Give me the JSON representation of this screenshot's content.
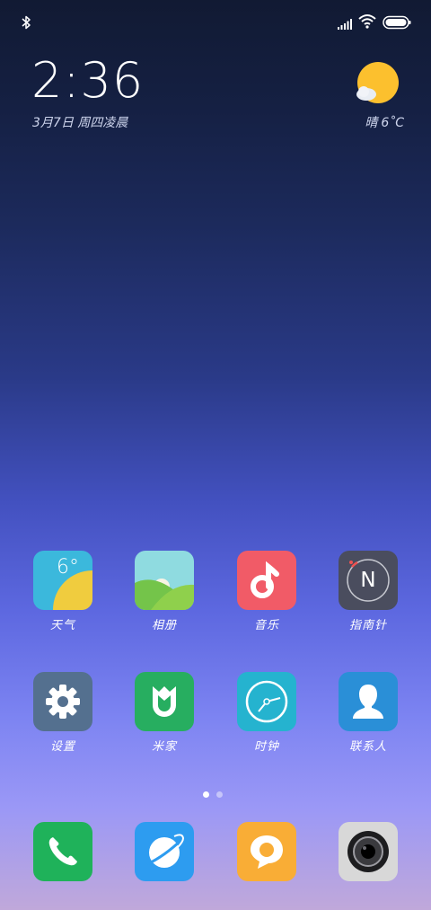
{
  "status_bar": {
    "icons": [
      "bluetooth-icon",
      "signal-icon",
      "wifi-icon",
      "battery-icon"
    ]
  },
  "clock_widget": {
    "time": "2:36",
    "date": "3月7日 周四凌晨"
  },
  "weather_widget": {
    "condition": "晴",
    "temperature": "6˚C",
    "icon": "sunny-cloud-icon"
  },
  "apps": [
    {
      "label": "天气",
      "icon": "weather-app-icon",
      "color": "#3bb8dc",
      "temp": "6°"
    },
    {
      "label": "相册",
      "icon": "gallery-icon",
      "color": "#8fdbe0"
    },
    {
      "label": "音乐",
      "icon": "music-icon",
      "color": "#f15b67"
    },
    {
      "label": "指南针",
      "icon": "compass-icon",
      "color": "#4a4d5e",
      "letter": "N"
    },
    {
      "label": "设置",
      "icon": "settings-icon",
      "color": "#54708f"
    },
    {
      "label": "米家",
      "icon": "mijia-icon",
      "color": "#27ae60"
    },
    {
      "label": "时钟",
      "icon": "clock-icon",
      "color": "#25b3cf"
    },
    {
      "label": "联系人",
      "icon": "contacts-icon",
      "color": "#2a8fd7"
    }
  ],
  "page_indicator": {
    "pages": 2,
    "current": 1
  },
  "dock": [
    {
      "icon": "phone-icon",
      "color": "#1fb25a"
    },
    {
      "icon": "browser-icon",
      "color": "#2d9cf0"
    },
    {
      "icon": "messages-icon",
      "color": "#f9ad36"
    },
    {
      "icon": "camera-icon",
      "color": "#d8d8d8"
    }
  ]
}
